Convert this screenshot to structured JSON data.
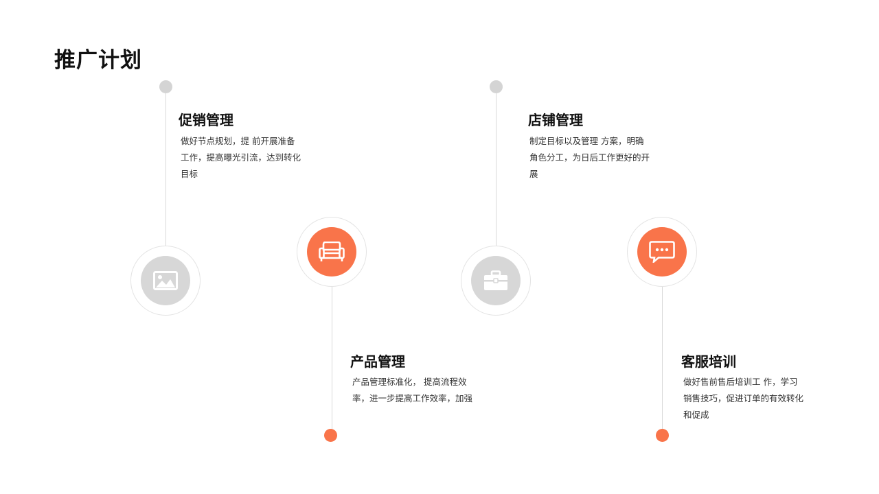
{
  "slide": {
    "title": "推广计划"
  },
  "colors": {
    "accent": "#f9744a",
    "neutral": "#d7d7d7",
    "line": "#d9d9d9",
    "text": "#111111"
  },
  "items": [
    {
      "title": "促销管理",
      "body": "做好节点规划，提 前开展准备工作，提高曝光引流，达到转化目标",
      "icon": "image-icon",
      "accent": false
    },
    {
      "title": "产品管理",
      "body": "产品管理标准化， 提高流程效率，进一步提高工作效率，加强",
      "icon": "sofa-icon",
      "accent": true
    },
    {
      "title": "店铺管理",
      "body": "制定目标以及管理 方案，明确角色分工，为日后工作更好的开展",
      "icon": "briefcase-icon",
      "accent": false
    },
    {
      "title": "客服培训",
      "body": "做好售前售后培训工 作，学习销售技巧，促进订单的有效转化和促成",
      "icon": "chat-icon",
      "accent": true
    }
  ]
}
